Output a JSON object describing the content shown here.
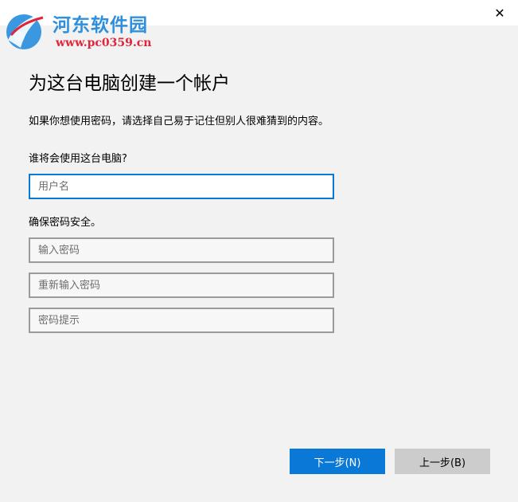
{
  "window": {
    "close_glyph": "✕"
  },
  "watermark": {
    "name": "河东软件园",
    "url": "www.pc0359.cn",
    "logo_icon": "swoosh-logo"
  },
  "page": {
    "title": "为这台电脑创建一个帐户",
    "intro": "如果你想使用密码，请选择自己易于记住但别人很难猜到的内容。",
    "user_question": "谁将会使用这台电脑?",
    "secure_label": "确保密码安全。"
  },
  "fields": {
    "username_placeholder": "用户名",
    "password_placeholder": "输入密码",
    "repassword_placeholder": "重新输入密码",
    "hint_placeholder": "密码提示"
  },
  "buttons": {
    "next_label": "下一步(N)",
    "back_label": "上一步(B)"
  },
  "colors": {
    "accent": "#0a78d7",
    "background": "#f2f2f2",
    "watermark_blue": "#2f8fdc",
    "watermark_red": "#e0263a"
  }
}
